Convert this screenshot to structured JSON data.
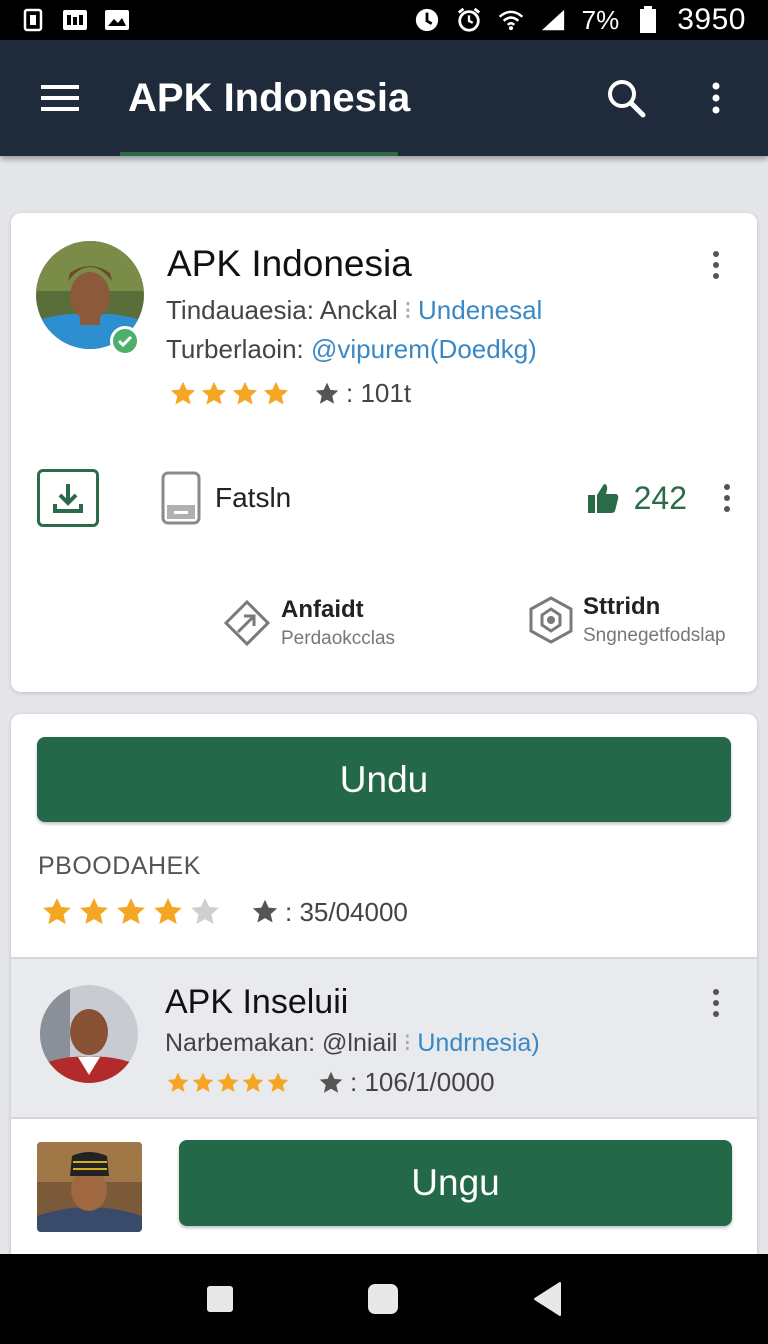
{
  "status_bar": {
    "battery_pct": "7%",
    "time": "3950"
  },
  "app_bar": {
    "title": "APK Indonesia"
  },
  "card1": {
    "name": "APK Indonesia",
    "line1_text": "Tindauaesia: Anckal",
    "line1_link": "Undenesal",
    "line2_text": "Turberlaoin:",
    "line2_link": "@vipurem(Doedkg)",
    "rating_stars": 4,
    "rating_count": ": 101t",
    "device_label": "Fatsln",
    "likes": "242",
    "feature1_title": "Anfaidt",
    "feature1_sub": "Perdaokcclas",
    "feature2_title": "Sttridn",
    "feature2_sub": "Sngnegetfodslap"
  },
  "card2": {
    "button_label": "Undu",
    "section_label": "PBOODAHEK",
    "rating_stars": 4,
    "rating_count": ": 35/04000",
    "item": {
      "name": "APK Inseluii",
      "line_text": "Narbemakan: @lniail",
      "line_link": "Undrnesia)",
      "rating_stars": 5,
      "rating_count": ": 106/1/0000"
    },
    "bottom_button_label": "Ungu"
  },
  "colors": {
    "appbar": "#1f2b3b",
    "accent_green": "#236848",
    "star": "#f5a623",
    "link": "#3a88c4"
  },
  "icons": {
    "menu": "hamburger-icon",
    "search": "search-icon",
    "more": "more-vert-icon",
    "download": "download-icon",
    "device": "phone-icon",
    "like": "thumbs-up-icon",
    "share": "share-icon",
    "settings": "settings-icon",
    "nav_recent": "square-icon",
    "nav_home": "home-icon",
    "nav_back": "back-triangle-icon"
  }
}
